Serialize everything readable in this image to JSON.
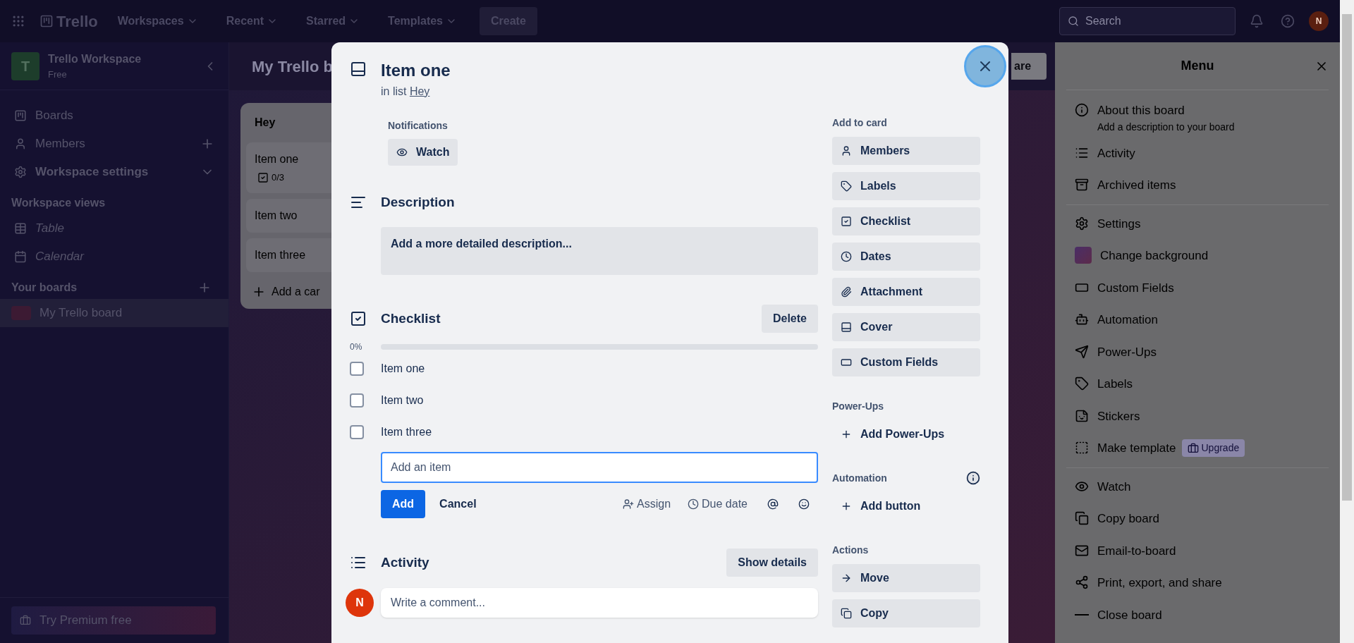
{
  "top_bar": {
    "logo": "Trello",
    "nav": [
      {
        "label": "Workspaces"
      },
      {
        "label": "Recent"
      },
      {
        "label": "Starred"
      },
      {
        "label": "Templates"
      }
    ],
    "create": "Create",
    "search": {
      "placeholder": "Search"
    },
    "avatar": "N"
  },
  "sidebar": {
    "workspace": {
      "initial": "T",
      "name": "Trello Workspace",
      "plan": "Free"
    },
    "items": [
      {
        "label": "Boards",
        "kind": "plain"
      },
      {
        "label": "Members",
        "kind": "add"
      },
      {
        "label": "Workspace settings",
        "kind": "expand"
      }
    ],
    "views_heading": "Workspace views",
    "views": [
      {
        "label": "Table"
      },
      {
        "label": "Calendar"
      }
    ],
    "boards_heading": "Your boards",
    "boards": [
      {
        "label": "My Trello board",
        "selected": true
      }
    ],
    "premium": "Try Premium free"
  },
  "board": {
    "title": "My Trello b",
    "share": "are",
    "list": {
      "title": "Hey",
      "cards": [
        {
          "title": "Item one",
          "badge": "0/3"
        },
        {
          "title": "Item two"
        },
        {
          "title": "Item three"
        }
      ],
      "add": "Add a car"
    }
  },
  "modal": {
    "title": "Item one",
    "list_prefix": "in list",
    "list_link": "Hey",
    "notifications": {
      "label": "Notifications",
      "button": "Watch"
    },
    "description": {
      "heading": "Description",
      "prompt": "Add a more detailed description..."
    },
    "checklist": {
      "heading": "Checklist",
      "delete": "Delete",
      "percent": "0%",
      "level": 0,
      "items": [
        {
          "label": "Item one",
          "checked": false
        },
        {
          "label": "Item two",
          "checked": false
        },
        {
          "label": "Item three",
          "checked": false
        }
      ],
      "new_item": {
        "placeholder": "Add an item"
      },
      "add": "Add",
      "cancel": "Cancel",
      "tools": [
        "Assign",
        "Due date"
      ]
    },
    "activity": {
      "heading": "Activity",
      "button": "Show details",
      "avatar": "N",
      "comment": {
        "placeholder": "Write a comment..."
      }
    },
    "sections": [
      {
        "heading": "Add to card",
        "kind": "filled",
        "buttons": [
          "Members",
          "Labels",
          "Checklist",
          "Dates",
          "Attachment",
          "Cover",
          "Custom Fields"
        ]
      },
      {
        "heading": "Power-Ups",
        "kind": "plain",
        "buttons": [
          "Add Power-Ups"
        ]
      },
      {
        "heading": "Automation",
        "kind": "plain",
        "help": true,
        "buttons": [
          "Add button"
        ]
      },
      {
        "heading": "Actions",
        "kind": "filled",
        "buttons": [
          "Move",
          "Copy"
        ]
      }
    ]
  },
  "menu": {
    "title": "Menu",
    "groups": [
      [
        {
          "label": "About this board",
          "sub": "Add a description to your board"
        },
        {
          "label": "Activity"
        },
        {
          "label": "Archived items"
        }
      ],
      [
        {
          "label": "Settings"
        },
        {
          "label": "Change background",
          "kind": "swatch"
        },
        {
          "label": "Custom Fields"
        },
        {
          "label": "Automation"
        },
        {
          "label": "Power-Ups"
        },
        {
          "label": "Labels"
        },
        {
          "label": "Stickers"
        },
        {
          "label": "Make template",
          "badge": "Upgrade"
        }
      ],
      [
        {
          "label": "Watch"
        },
        {
          "label": "Copy board"
        },
        {
          "label": "Email-to-board"
        },
        {
          "label": "Print, export, and share"
        },
        {
          "label": "Close board"
        }
      ]
    ]
  }
}
